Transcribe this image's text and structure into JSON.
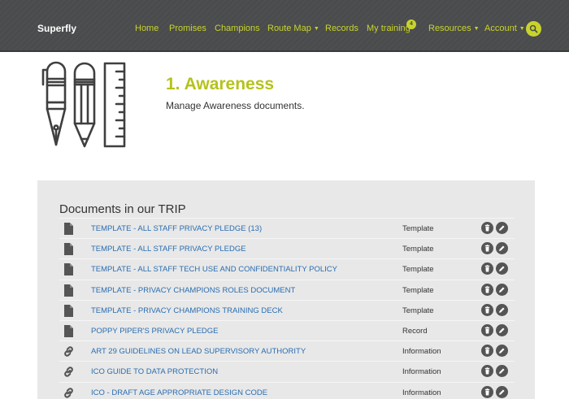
{
  "brand": "Superfly",
  "nav": {
    "items": [
      {
        "label": "Home"
      },
      {
        "label": "Promises"
      },
      {
        "label": "Champions"
      },
      {
        "label": "Route Map"
      },
      {
        "label": "Records"
      },
      {
        "label": "My training"
      },
      {
        "label": "Resources"
      },
      {
        "label": "Account"
      }
    ],
    "training_badge": "4",
    "accent": "#c8d42a"
  },
  "page": {
    "title": "1. Awareness",
    "subtitle": "Manage Awareness documents."
  },
  "documents": {
    "heading": "Documents in our TRIP",
    "rows": [
      {
        "icon": "file-icon",
        "title": "TEMPLATE - ALL STAFF PRIVACY PLEDGE (13)",
        "type": "Template"
      },
      {
        "icon": "file-icon",
        "title": "TEMPLATE - ALL STAFF PRIVACY PLEDGE",
        "type": "Template"
      },
      {
        "icon": "file-icon",
        "title": "TEMPLATE - ALL STAFF TECH USE AND CONFIDENTIALITY POLICY",
        "type": "Template"
      },
      {
        "icon": "file-icon",
        "title": "TEMPLATE - PRIVACY CHAMPIONS ROLES DOCUMENT",
        "type": "Template"
      },
      {
        "icon": "file-icon",
        "title": "TEMPLATE - PRIVACY CHAMPIONS TRAINING DECK",
        "type": "Template"
      },
      {
        "icon": "file-icon",
        "title": "POPPY PIPER'S PRIVACY PLEDGE",
        "type": "Record"
      },
      {
        "icon": "link-icon",
        "title": "ART 29 GUIDELINES ON LEAD SUPERVISORY AUTHORITY",
        "type": "Information"
      },
      {
        "icon": "link-icon",
        "title": "ICO GUIDE TO DATA PROTECTION",
        "type": "Information"
      },
      {
        "icon": "link-icon",
        "title": "ICO - DRAFT AGE APPROPRIATE DESIGN CODE",
        "type": "Information"
      }
    ]
  }
}
